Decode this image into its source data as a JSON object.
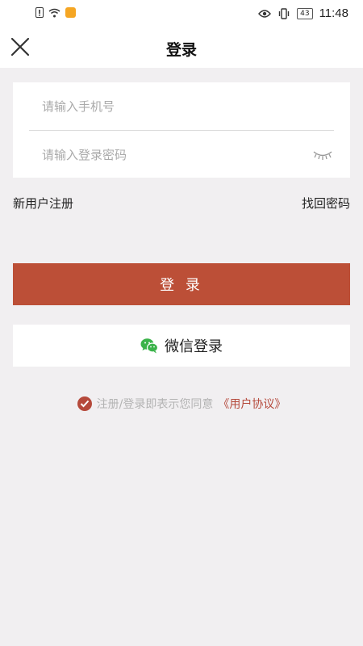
{
  "status_bar": {
    "time": "11:48",
    "battery": "43"
  },
  "nav": {
    "title": "登录",
    "close_icon": "close-icon"
  },
  "form": {
    "phone_placeholder": "请输入手机号",
    "password_placeholder": "请输入登录密码"
  },
  "links": {
    "register": "新用户注册",
    "forgot_password": "找回密码"
  },
  "buttons": {
    "login": "登 录",
    "wechat_login": "微信登录"
  },
  "agreement": {
    "text": "注册/登录即表示您同意",
    "link": "《用户协议》"
  },
  "colors": {
    "accent": "#bc4f37",
    "wechat_green": "#3bb34a",
    "background": "#f1eff1"
  }
}
